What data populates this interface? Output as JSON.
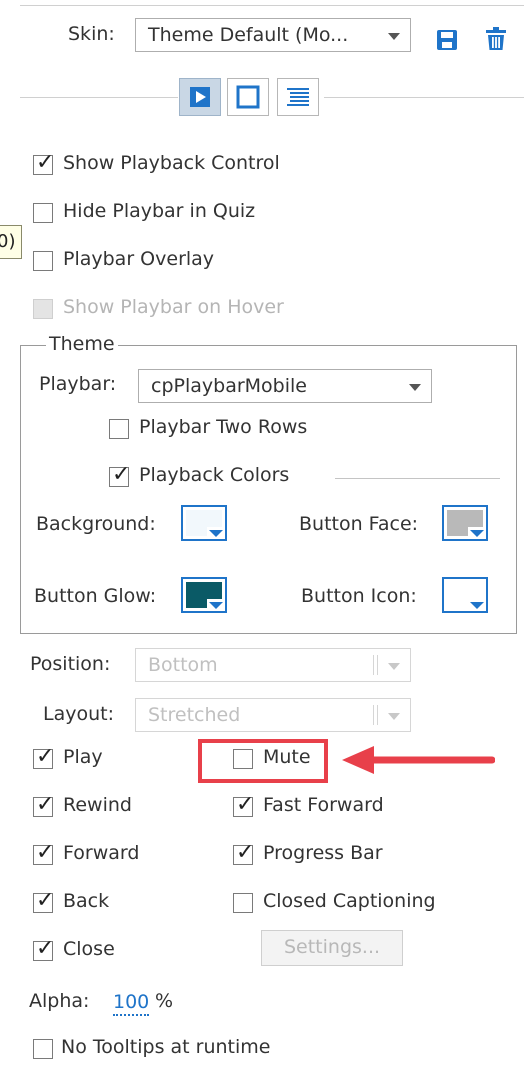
{
  "skin": {
    "label": "Skin:",
    "value": "Theme Default (Mo...",
    "save_icon": "save-icon",
    "delete_icon": "trash-icon"
  },
  "view_buttons": [
    {
      "name": "playback-view",
      "icon": "play-icon",
      "active": true
    },
    {
      "name": "border-view",
      "icon": "square-icon",
      "active": false
    },
    {
      "name": "toc-view",
      "icon": "list-icon",
      "active": false
    }
  ],
  "options": {
    "show_playback_control": "Show Playback Control",
    "hide_playbar_in_quiz": "Hide Playbar in Quiz",
    "playbar_overlay": "Playbar Overlay",
    "show_playbar_on_hover": "Show Playbar on Hover"
  },
  "tooltip_fragment": "0)",
  "theme": {
    "legend": "Theme",
    "playbar_label": "Playbar:",
    "playbar_value": "cpPlaybarMobile",
    "two_rows": "Playbar Two Rows",
    "playback_colors": "Playback Colors",
    "background_label": "Background:",
    "button_face_label": "Button Face:",
    "button_glow_label": "Button Glow:",
    "button_icon_label": "Button Icon:",
    "colors": {
      "background": "#f2f8fc",
      "button_face": "#b9b9b9",
      "button_glow": "#0a5a66",
      "button_icon": "#ffffff",
      "swatch_border": "#1f74c9"
    }
  },
  "position": {
    "label": "Position:",
    "value": "Bottom"
  },
  "layout": {
    "label": "Layout:",
    "value": "Stretched"
  },
  "controls": {
    "play": "Play",
    "mute": "Mute",
    "rewind": "Rewind",
    "fast_forward": "Fast Forward",
    "forward": "Forward",
    "progress_bar": "Progress Bar",
    "back": "Back",
    "closed_captioning": "Closed Captioning",
    "close": "Close",
    "settings": "Settings..."
  },
  "alpha": {
    "label": "Alpha:",
    "value": "100",
    "unit": "%"
  },
  "no_tooltips": "No Tooltips at runtime",
  "annotation": {
    "highlight_color": "#e8404a"
  }
}
